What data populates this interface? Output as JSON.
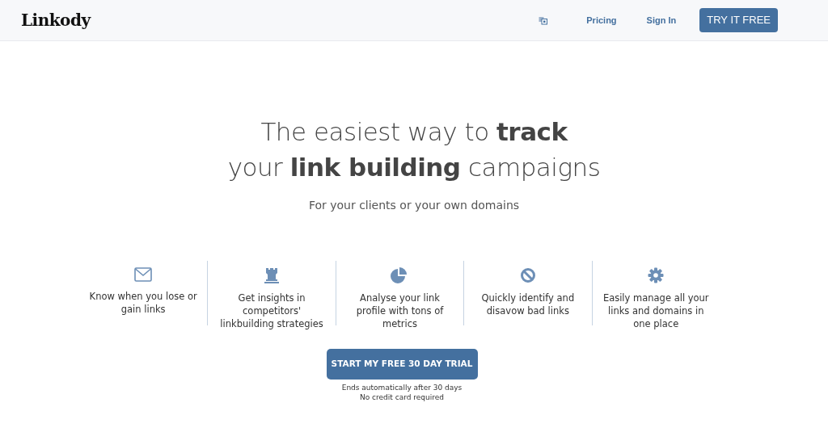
{
  "navbar": {
    "logo": "Linkody",
    "links": [
      "Pricing",
      "Sign In"
    ],
    "cta": "TRY IT FREE"
  },
  "hero": {
    "headline": [
      "The easiest way to **track**",
      "your **link building** campaigns"
    ],
    "subtitle": "For your clients or your own domains"
  },
  "features": [
    {
      "kind": "envelope",
      "text": "Know when you lose or gain links"
    },
    {
      "kind": "tower",
      "text": "Get insights in competitors' linkbuilding strategies"
    },
    {
      "kind": "pie",
      "text": "Analyse your link profile with tons of metrics"
    },
    {
      "kind": "ban",
      "text": "Quickly identify and disavow bad links"
    },
    {
      "kind": "gear",
      "text": "Easily manage all your links and domains in one place"
    }
  ],
  "trial": {
    "button": "START MY FREE 30 DAY TRIAL",
    "notes": [
      "Ends automatically after 30 days",
      "No credit card required"
    ]
  }
}
